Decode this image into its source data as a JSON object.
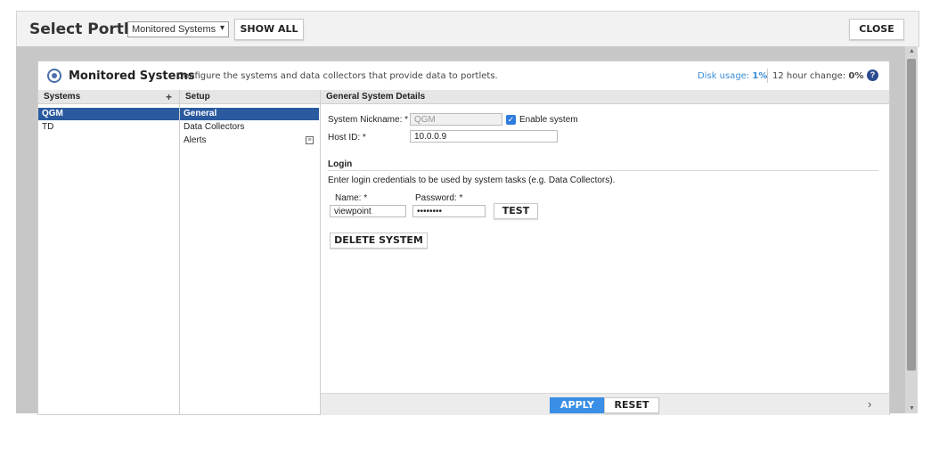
{
  "topbar": {
    "title": "Select Portlet",
    "select_value": "Monitored Systems",
    "show_all_label": "SHOW ALL",
    "close_label": "CLOSE"
  },
  "portlet": {
    "title": "Monitored Systems",
    "description": "Configure the systems and data collectors that provide data to portlets.",
    "disk_usage_label": "Disk usage:",
    "disk_usage_value": "1%",
    "change_label": "12 hour change:",
    "change_value": "0%",
    "help_icon": "?"
  },
  "columns": {
    "systems": "Systems",
    "add": "+",
    "setup": "Setup",
    "general": "General System Details"
  },
  "systems": [
    {
      "label": "QGM",
      "selected": true
    },
    {
      "label": "TD",
      "selected": false
    }
  ],
  "setup_items": [
    {
      "label": "General",
      "selected": true
    },
    {
      "label": "Data Collectors",
      "selected": false
    },
    {
      "label": "Alerts",
      "selected": false
    }
  ],
  "details": {
    "nickname_label": "System Nickname: *",
    "nickname_value": "QGM",
    "enable_label": "Enable system",
    "enable_checked": true,
    "host_label": "Host ID: *",
    "host_value": "10.0.0.9"
  },
  "login": {
    "title": "Login",
    "description": "Enter login credentials to be used by system tasks (e.g. Data Collectors).",
    "name_label": "Name: *",
    "name_value": "viewpoint",
    "password_label": "Password: *",
    "password_value": "••••••••",
    "test_label": "TEST"
  },
  "delete_label": "DELETE SYSTEM",
  "footer": {
    "apply_label": "APPLY",
    "reset_label": "RESET",
    "next_icon": "›"
  },
  "colors": {
    "selection": "#2b5a9f",
    "apply": "#3a8ee6",
    "checkbox": "#2e7be0",
    "disk_usage": "#3a8bd6"
  }
}
